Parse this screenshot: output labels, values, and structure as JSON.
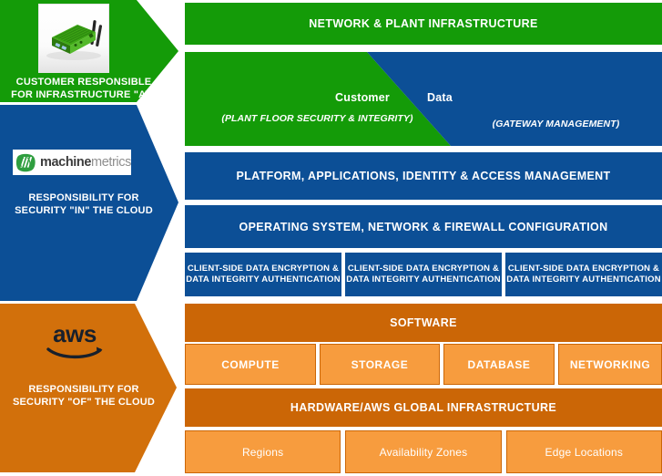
{
  "left_column": {
    "customer": {
      "icon": "edge-gateway-device-photo",
      "caption": "CUSTOMER RESPONSIBLE FOR INFRASTRUCTURE \"AT\" PLANT",
      "color": "#149b08"
    },
    "machinemetrics": {
      "logo_bold": "machine",
      "logo_light": "metrics",
      "logo_icon": "machinemetrics-logo-icon",
      "caption": "RESPONSIBILITY FOR SECURITY \"IN\" THE CLOUD",
      "color": "#0c4f96"
    },
    "aws": {
      "logo_text": "aws",
      "logo_icon": "aws-smile-icon",
      "caption": "RESPONSIBILITY FOR SECURITY \"OF\" THE CLOUD",
      "color": "#d2700b"
    }
  },
  "stack": {
    "network_plant": "NETWORK & PLANT INFRASTRUCTURE",
    "customer_data": {
      "label_left": "Customer",
      "label_right": "Data",
      "sub_left": "(PLANT FLOOR SECURITY & INTEGRITY)",
      "sub_right": "(GATEWAY MANAGEMENT)"
    },
    "platform": "PLATFORM, APPLICATIONS, IDENTITY & ACCESS MANAGEMENT",
    "operating_system": "OPERATING SYSTEM, NETWORK & FIREWALL CONFIGURATION",
    "client_side": [
      "CLIENT-SIDE DATA ENCRYPTION & DATA INTEGRITY AUTHENTICATION",
      "CLIENT-SIDE DATA ENCRYPTION & DATA INTEGRITY AUTHENTICATION",
      "CLIENT-SIDE DATA ENCRYPTION & DATA INTEGRITY AUTHENTICATION"
    ],
    "software": "SOFTWARE",
    "services": [
      "COMPUTE",
      "STORAGE",
      "DATABASE",
      "NETWORKING"
    ],
    "hardware": "HARDWARE/AWS GLOBAL INFRASTRUCTURE",
    "global_infra": [
      "Regions",
      "Availability Zones",
      "Edge Locations"
    ]
  },
  "colors": {
    "green": "#149b08",
    "blue": "#0c4f96",
    "orange_dark": "#cb6606",
    "orange_light": "#f79c3e"
  }
}
